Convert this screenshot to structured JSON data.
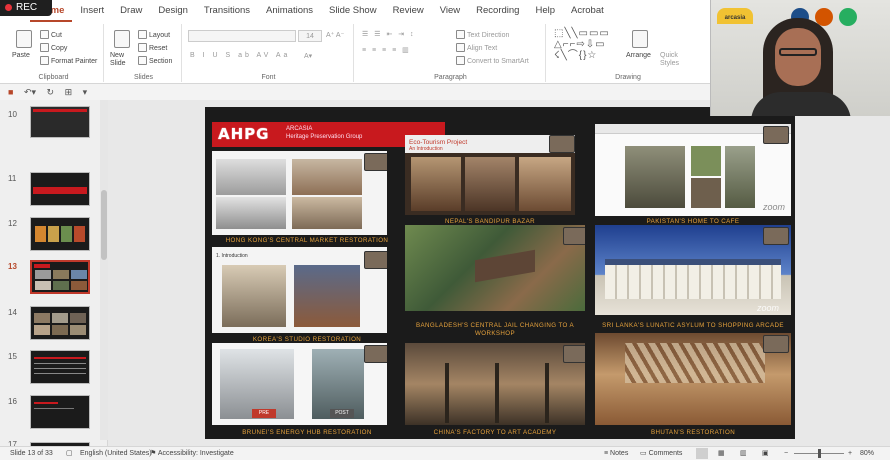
{
  "recording": {
    "label": "REC"
  },
  "ribbon_tabs": [
    "Home",
    "Insert",
    "Draw",
    "Design",
    "Transitions",
    "Animations",
    "Slide Show",
    "Review",
    "View",
    "Recording",
    "Help",
    "Acrobat"
  ],
  "clipboard": {
    "paste": "Paste",
    "cut": "Cut",
    "copy": "Copy",
    "format_painter": "Format Painter",
    "label": "Clipboard"
  },
  "slides_group": {
    "new_slide": "New Slide",
    "layout": "Layout",
    "reset": "Reset",
    "section": "Section",
    "label": "Slides"
  },
  "font_group": {
    "size": "14",
    "label": "Font"
  },
  "paragraph_group": {
    "text_direction": "Text Direction",
    "align_text": "Align Text",
    "smartart": "Convert to SmartArt",
    "label": "Paragraph"
  },
  "drawing_group": {
    "arrange": "Arrange",
    "quick_styles": "Quick Styles",
    "label": "Drawing"
  },
  "thumbnails": [
    {
      "num": "10"
    },
    {
      "num": "11"
    },
    {
      "num": "12"
    },
    {
      "num": "13",
      "selected": true
    },
    {
      "num": "14"
    },
    {
      "num": "15"
    },
    {
      "num": "16"
    },
    {
      "num": "17"
    }
  ],
  "slide": {
    "logo": "AHPG",
    "org": "ARCASIA",
    "org_sub": "Heritage Preservation Group",
    "captions": [
      "HONG KONG'S CENTRAL MARKET RESTORATION",
      "NEPAL'S BANDIPUR BAZAR",
      "PAKISTAN'S HOME TO CAFE",
      "KOREA'S STUDIO RESTORATION",
      "BANGLADESH'S CENTRAL JAIL CHANGING TO A WORKSHOP",
      "SRI LANKA'S LUNATIC ASYLUM TO SHOPPING ARCADE",
      "BRUNEI'S ENERGY HUB RESTORATION",
      "CHINA'S FACTORY TO ART ACADEMY",
      "BHUTAN'S RESTORATION"
    ],
    "inner_title": "Eco-Tourism Project",
    "inner_sub": "An Introduction",
    "intro_label": "1. Introduction",
    "pre": "PRE",
    "post": "POST",
    "zoom": "zoom"
  },
  "status": {
    "slide_of": "Slide 13 of 33",
    "language": "English (United States)",
    "accessibility": "Accessibility: Investigate",
    "notes": "Notes",
    "comments": "Comments",
    "zoom": "80%"
  },
  "video": {
    "badge": "arcasia"
  },
  "colors": {
    "accent": "#b7472a",
    "slide_red": "#c8191e",
    "caption": "#e6a23c"
  }
}
